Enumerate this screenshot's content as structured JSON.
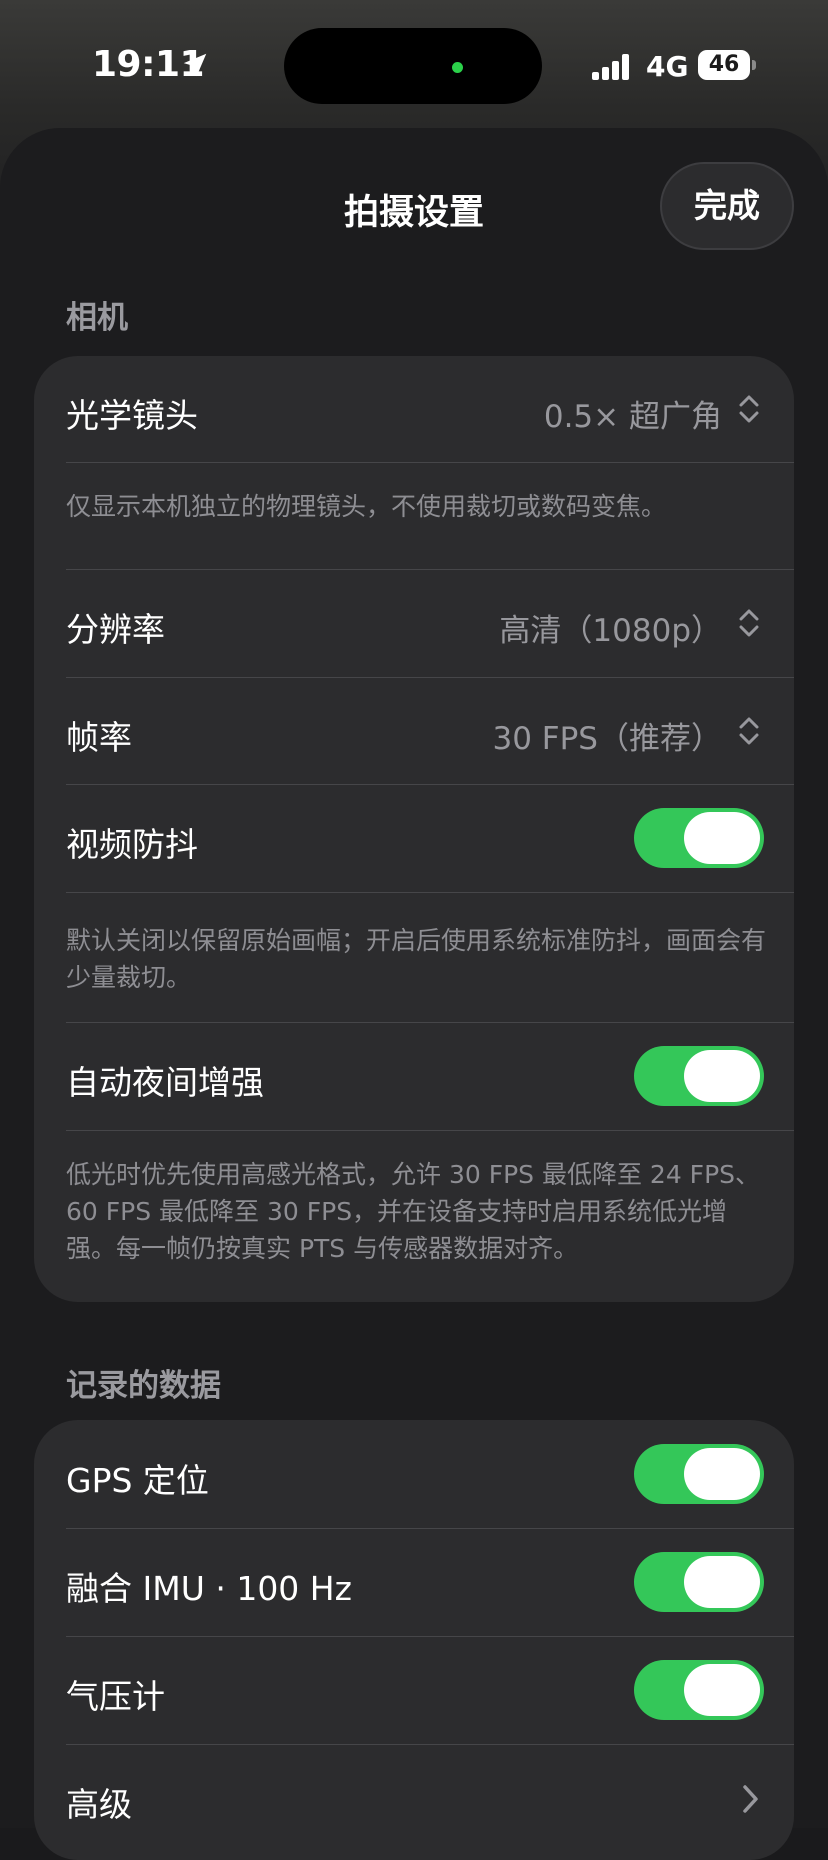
{
  "status_bar": {
    "time": "19:11",
    "network": "4G",
    "battery": "46"
  },
  "sheet": {
    "title": "拍摄设置",
    "done_label": "完成"
  },
  "camera_section": {
    "header": "相机",
    "lens": {
      "label": "光学镜头",
      "value": "0.5× 超广角"
    },
    "lens_note": "仅显示本机独立的物理镜头，不使用裁切或数码变焦。",
    "resolution": {
      "label": "分辨率",
      "value": "高清（1080p）"
    },
    "frame_rate": {
      "label": "帧率",
      "value": "30 FPS（推荐）"
    },
    "stabilization": {
      "label": "视频防抖",
      "on": true
    },
    "stabilization_note": "默认关闭以保留原始画幅；开启后使用系统标准防抖，画面会有少量裁切。",
    "night_boost": {
      "label": "自动夜间增强",
      "on": true
    },
    "night_note": "低光时优先使用高感光格式，允许 30 FPS 最低降至 24 FPS、60 FPS 最低降至 30 FPS，并在设备支持时启用系统低光增强。每一帧仍按真实 PTS 与传感器数据对齐。"
  },
  "data_section": {
    "header": "记录的数据",
    "gps": {
      "label": "GPS 定位",
      "on": true
    },
    "imu": {
      "label": "融合 IMU · 100 Hz",
      "on": true
    },
    "barometer": {
      "label": "气压计",
      "on": true
    },
    "advanced": {
      "label": "高级"
    }
  },
  "colors": {
    "toggle_on": "#34c759",
    "background": "#1c1c1e",
    "card": "#2c2c2e",
    "secondary_text": "#8e8e93"
  }
}
